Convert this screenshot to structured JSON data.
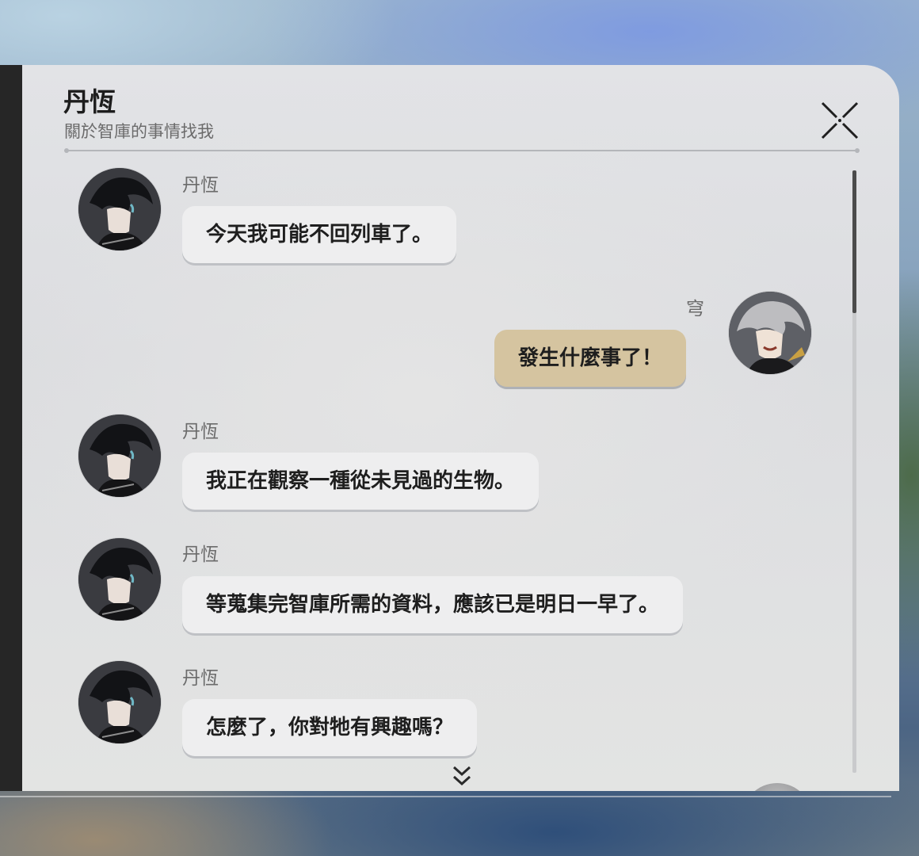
{
  "header": {
    "title": "丹恆",
    "subtitle": "關於智庫的事情找我",
    "close_icon": "close-x-icon"
  },
  "messages": [
    {
      "sender": "丹恆",
      "side": "left",
      "avatar": "danheng-avatar",
      "text": "今天我可能不回列車了。"
    },
    {
      "sender": "穹",
      "side": "right",
      "avatar": "stelle-caelus-avatar",
      "text": "發生什麼事了！"
    },
    {
      "sender": "丹恆",
      "side": "left",
      "avatar": "danheng-avatar",
      "text": "我正在觀察一種從未見過的生物。"
    },
    {
      "sender": "丹恆",
      "side": "left",
      "avatar": "danheng-avatar",
      "text": "等蒐集完智庫所需的資料，應該已是明日一早了。"
    },
    {
      "sender": "丹恆",
      "side": "left",
      "avatar": "danheng-avatar",
      "text": "怎麼了，你對牠有興趣嗎？"
    }
  ],
  "scroll_more_icon": "double-chevron-down-icon",
  "colors": {
    "own_bubble": "#d5c4a0",
    "other_bubble": "#eeeeef",
    "panel_bg": "#e0e1e3",
    "sender_text": "#6b6b6b"
  }
}
